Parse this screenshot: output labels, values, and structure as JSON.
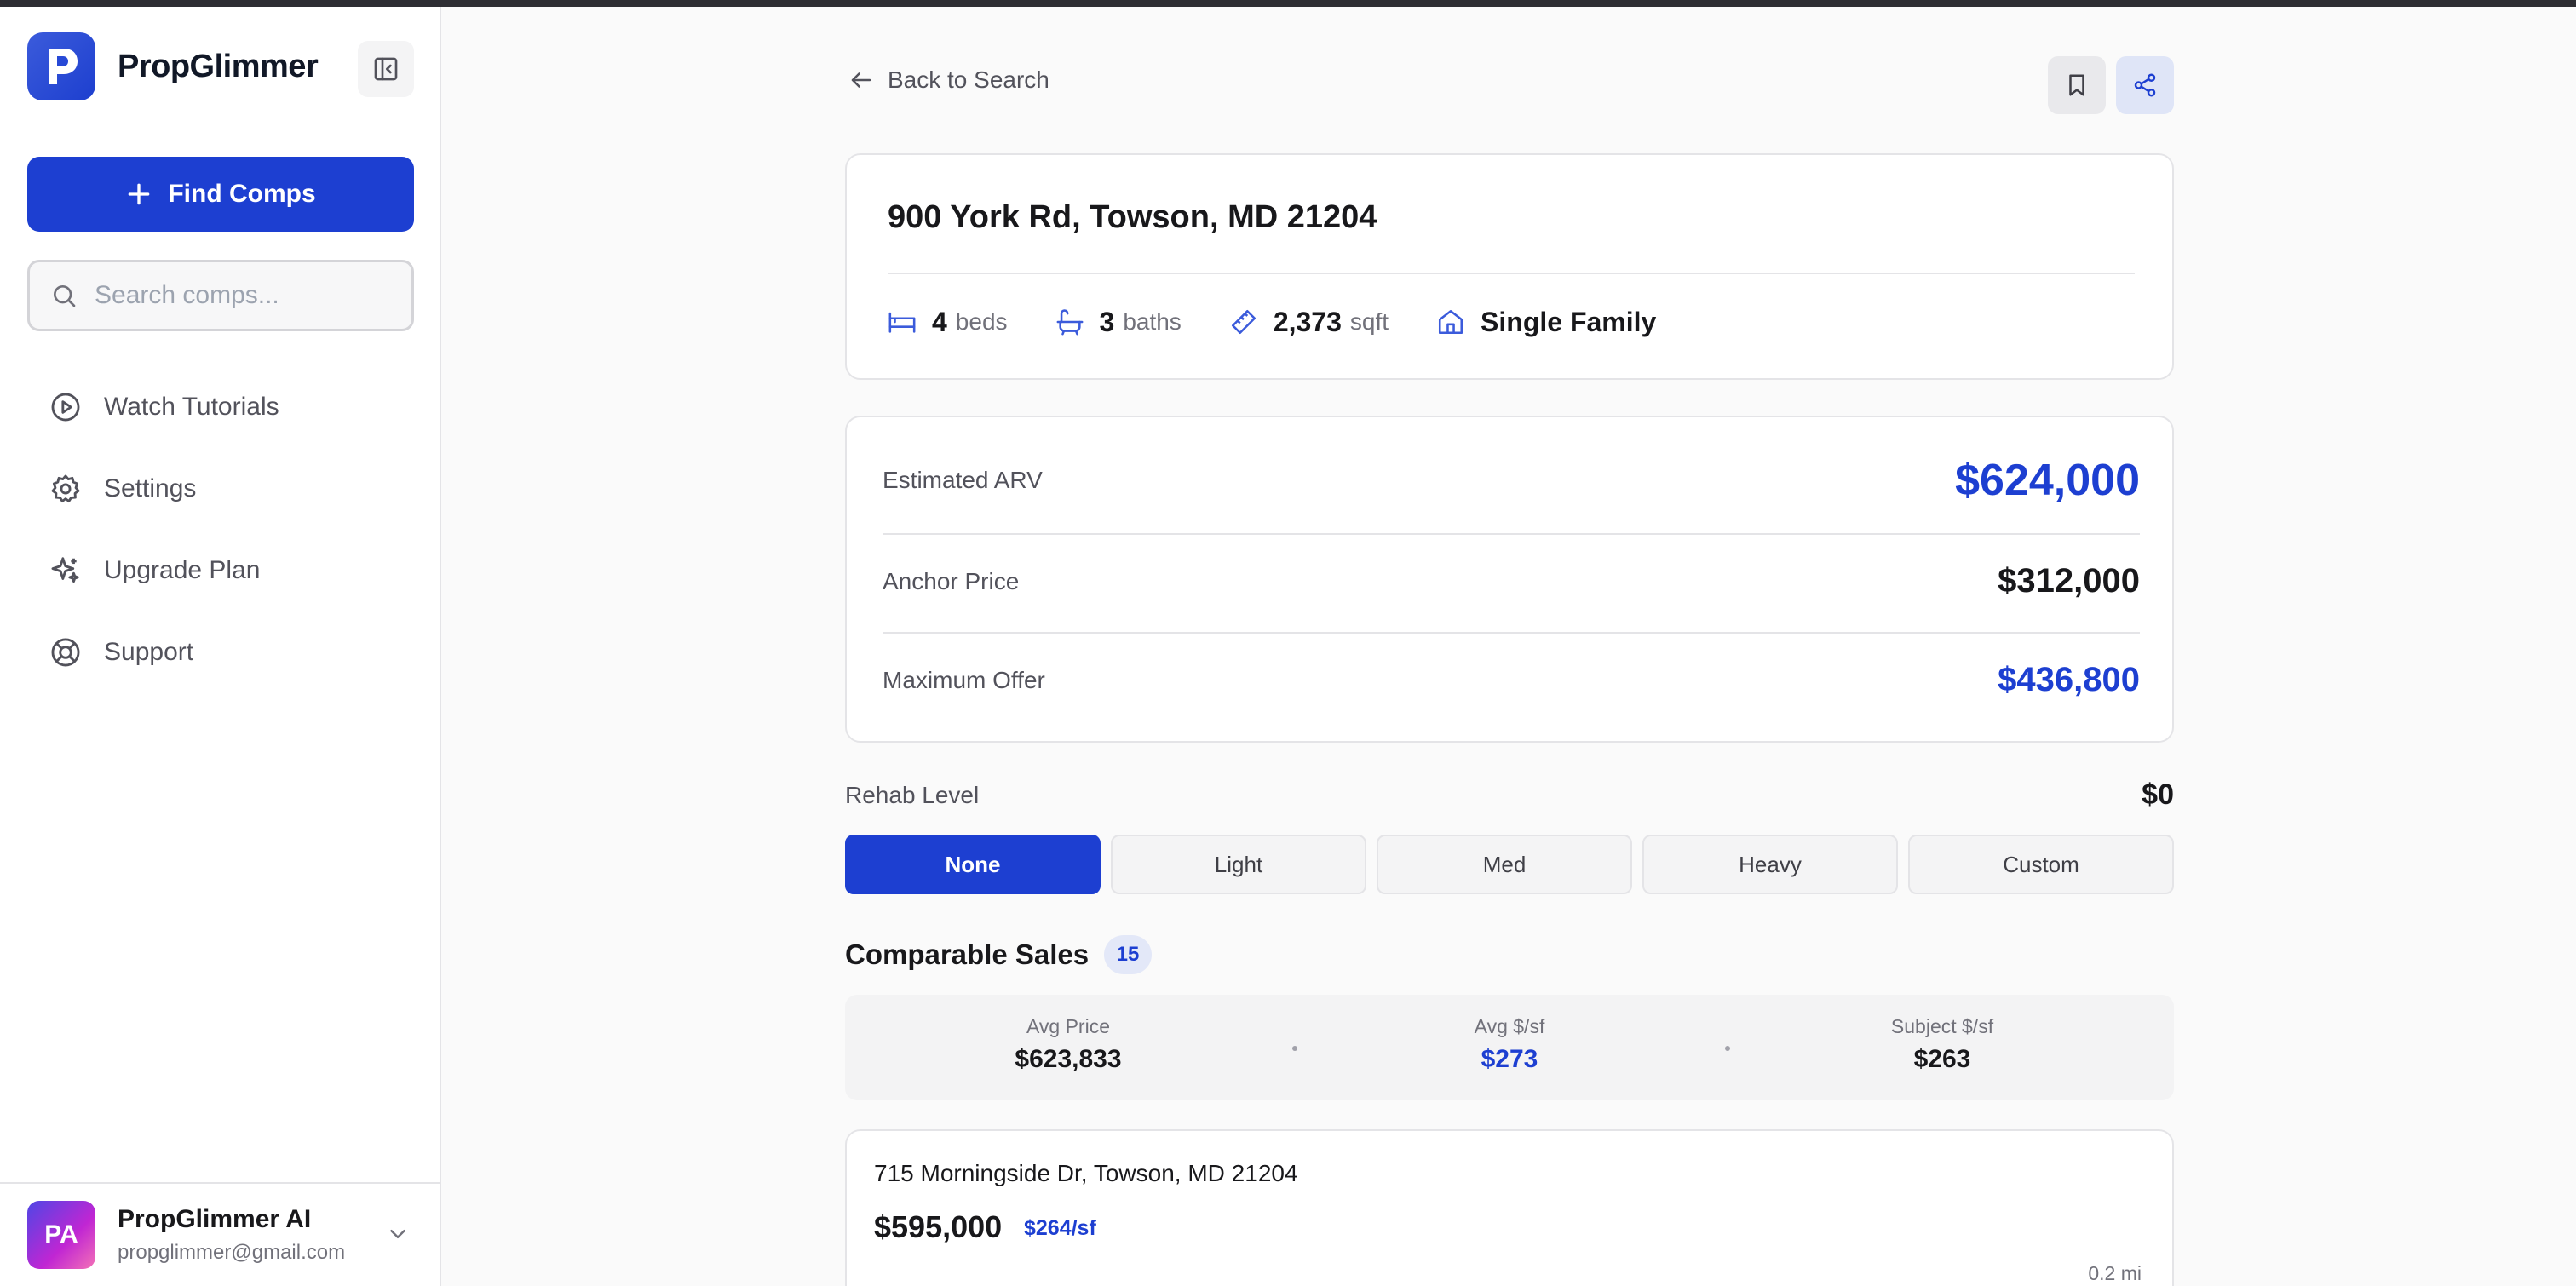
{
  "sidebar": {
    "brand_name": "PropGlimmer",
    "find_comps_label": "Find Comps",
    "search_placeholder": "Search comps...",
    "nav": [
      {
        "label": "Watch Tutorials",
        "icon": "play-circle-icon"
      },
      {
        "label": "Settings",
        "icon": "gear-icon"
      },
      {
        "label": "Upgrade Plan",
        "icon": "sparkles-icon"
      },
      {
        "label": "Support",
        "icon": "lifebuoy-icon"
      }
    ],
    "user": {
      "initials": "PA",
      "name": "PropGlimmer AI",
      "email": "propglimmer@gmail.com"
    }
  },
  "header": {
    "back_label": "Back to Search"
  },
  "property": {
    "address": "900 York Rd, Towson, MD 21204",
    "beds": "4",
    "beds_label": "beds",
    "baths": "3",
    "baths_label": "baths",
    "sqft": "2,373",
    "sqft_label": "sqft",
    "type": "Single Family"
  },
  "valuation": {
    "arv_label": "Estimated ARV",
    "arv_value": "$624,000",
    "anchor_label": "Anchor Price",
    "anchor_value": "$312,000",
    "max_offer_label": "Maximum Offer",
    "max_offer_value": "$436,800"
  },
  "rehab": {
    "label": "Rehab Level",
    "value": "$0",
    "options": [
      "None",
      "Light",
      "Med",
      "Heavy",
      "Custom"
    ],
    "selected": "None"
  },
  "comps": {
    "title": "Comparable Sales",
    "count": "15",
    "summary": {
      "avg_price_label": "Avg Price",
      "avg_price": "$623,833",
      "avg_psf_label": "Avg $/sf",
      "avg_psf": "$273",
      "subject_psf_label": "Subject $/sf",
      "subject_psf": "$263"
    },
    "items": [
      {
        "address": "715 Morningside Dr, Towson, MD 21204",
        "price": "$595,000",
        "ppsf": "$264/sf",
        "distance": "0.2 mi"
      }
    ]
  },
  "colors": {
    "accent": "#1d3fd1",
    "text": "#18181b",
    "muted": "#71717a",
    "border": "#e4e4e7"
  }
}
